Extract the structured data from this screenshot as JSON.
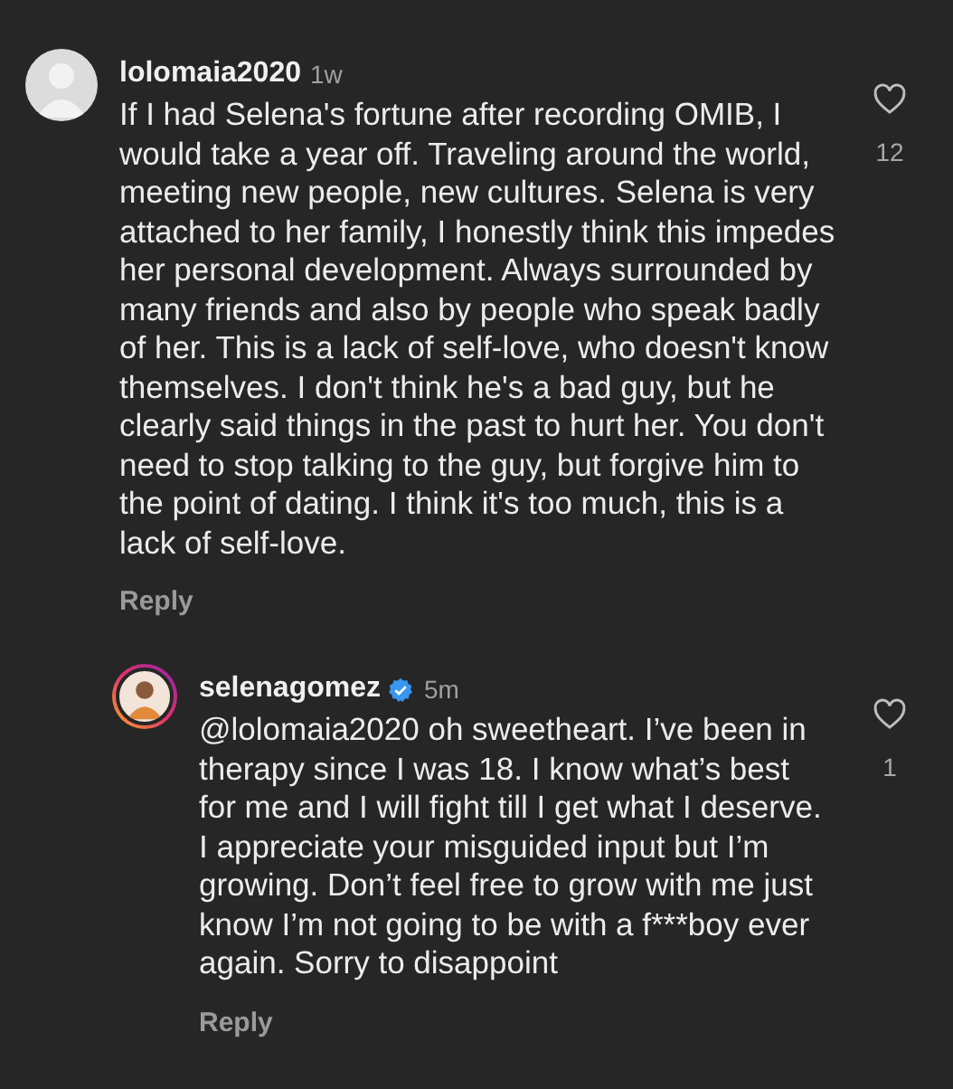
{
  "comments": [
    {
      "username": "lolomaia2020",
      "verified": false,
      "story_ring": false,
      "time": "1w",
      "text": "If I had Selena's fortune after recording OMIB, I would take a year off. Traveling around the world, meeting new people, new cultures. Selena is very attached to her family, I honestly think this impedes her personal development. Always surrounded by many friends and also by people who speak badly of her. This is a lack of self-love, who doesn't know themselves. I don't think he's a bad guy, but he clearly said things in the past to hurt her. You don't need to stop talking to the guy, but forgive him to the point of dating. I think it's too much, this is a lack of self-love.",
      "likes": "12",
      "reply_label": "Reply",
      "replies": [
        {
          "username": "selenagomez",
          "verified": true,
          "story_ring": true,
          "time": "5m",
          "text": "@lolomaia2020 oh sweetheart. I’ve been in therapy since I was 18. I know what’s best for me and I will fight till I get what I deserve. I appreciate your misguided input but I’m growing. Don’t feel free to grow with me just know I’m not going to be with a f***boy ever again. Sorry to disappoint",
          "likes": "1",
          "reply_label": "Reply"
        }
      ]
    }
  ]
}
